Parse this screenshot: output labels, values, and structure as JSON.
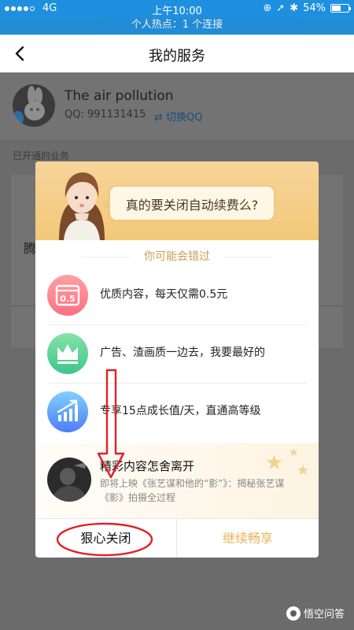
{
  "status_bar": {
    "carrier": "4G",
    "time": "上午10:00",
    "battery": "54%",
    "battery_level": 0.54
  },
  "hotspot_bar": {
    "text": "个人热点：1 个连接"
  },
  "navbar": {
    "title": "我的服务",
    "back_icon": "chevron-left-icon"
  },
  "profile": {
    "name": "The air pollution",
    "qq": "QQ: 991131415",
    "switch_label": "⇄ 切换QQ"
  },
  "section": {
    "label": "已开通的业务",
    "service_partial": "腾"
  },
  "dialog": {
    "question": "真的要关闭自动续费么?",
    "miss_label": "你可能会错过",
    "features": [
      {
        "icon": "price-tag-icon",
        "icon_text": "0.5",
        "text": "优质内容，每天仅需0.5元"
      },
      {
        "icon": "crown-icon",
        "text": "广告、渣画质一边去，我要最好的"
      },
      {
        "icon": "growth-chart-icon",
        "text": "专享15点成长值/天，直通高等级"
      }
    ],
    "promo": {
      "title": "精彩内容怎舍离开",
      "subtitle": "即将上映《张艺谋和他的“影”》：揭秘张艺谋《影》拍摄全过程"
    },
    "buttons": {
      "close": "狠心关闭",
      "continue": "继续畅享"
    }
  },
  "colors": {
    "status_blue": "#1f8fe0",
    "accent_gold": "#e9b45a",
    "annotation_red": "#e0202a"
  },
  "watermark": {
    "text": "悟空问答"
  }
}
